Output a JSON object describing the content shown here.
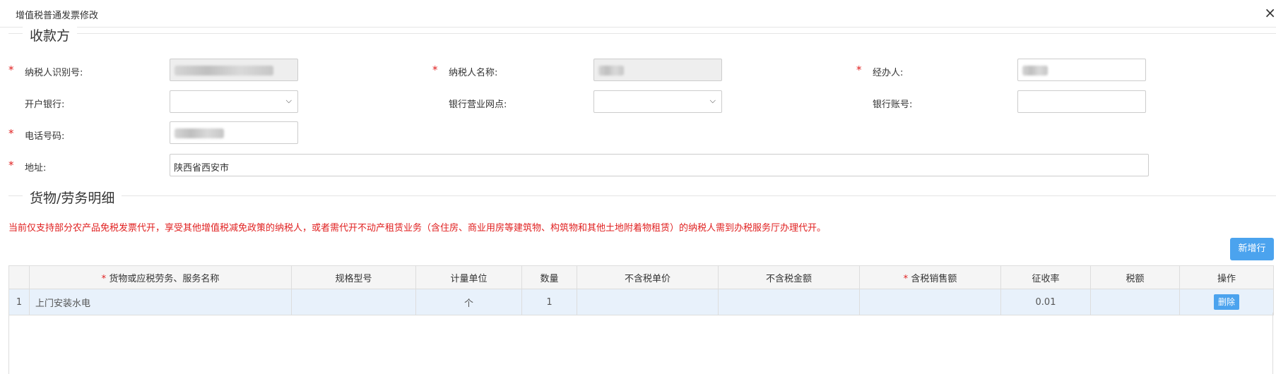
{
  "dialog": {
    "title": "增值税普通发票修改",
    "close_glyph": "×"
  },
  "payee": {
    "legend": "收款方",
    "taxpayer_id_label": "纳税人识别号:",
    "taxpayer_name_label": "纳税人名称:",
    "handler_label": "经办人:",
    "bank_label": "开户银行:",
    "bank_branch_label": "银行营业网点:",
    "bank_account_label": "银行账号:",
    "phone_label": "电话号码:",
    "address_label": "地址:",
    "address_value": "陕西省西安市",
    "bank_value": "",
    "bank_branch_value": "",
    "bank_account_value": ""
  },
  "goods": {
    "legend": "货物/劳务明细",
    "notice": "当前仅支持部分农产品免税发票代开，享受其他增值税减免政策的纳税人，或者需代开不动产租赁业务（含住房、商业用房等建筑物、构筑物和其他土地附着物租赁）的纳税人需到办税服务厅办理代开。",
    "add_row_label": "新增行",
    "columns": [
      "",
      "货物或应税劳务、服务名称",
      "规格型号",
      "计量单位",
      "数量",
      "不含税单价",
      "不含税金额",
      "含税销售额",
      "征收率",
      "税额",
      "操作"
    ],
    "required_mark": "*",
    "rows": [
      {
        "index": "1",
        "name": "上门安装水电",
        "spec": "",
        "unit": "个",
        "qty": "1",
        "unit_price": "",
        "amount": "",
        "tax_incl": "",
        "rate": "0.01",
        "tax": "",
        "action": "删除"
      }
    ]
  }
}
